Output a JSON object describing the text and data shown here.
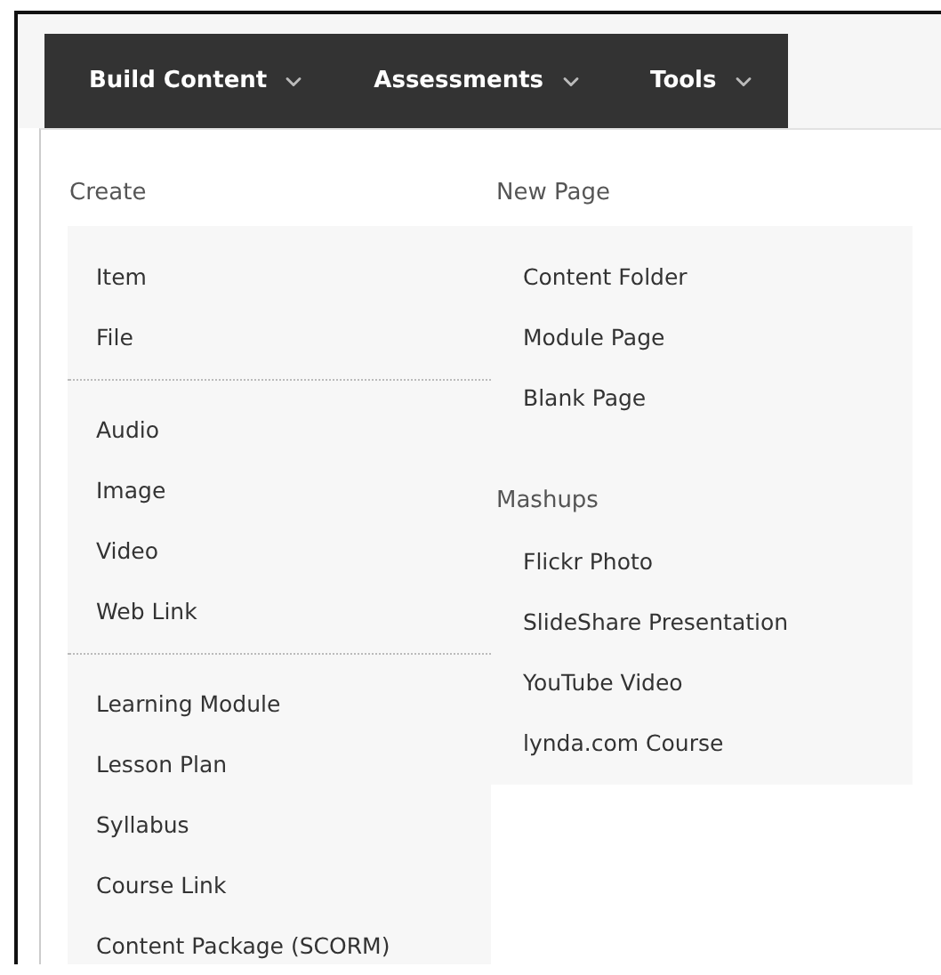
{
  "nav": [
    {
      "label": "Build Content"
    },
    {
      "label": "Assessments"
    },
    {
      "label": "Tools"
    }
  ],
  "menu": {
    "columns": [
      {
        "heading": "Create",
        "sections": [
          {
            "items": [
              "Item",
              "File"
            ]
          },
          {
            "items": [
              "Audio",
              "Image",
              "Video",
              "Web Link"
            ]
          },
          {
            "items": [
              "Learning Module",
              "Lesson Plan",
              "Syllabus",
              "Course Link",
              "Content Package (SCORM)"
            ]
          }
        ]
      },
      {
        "heading": "New Page",
        "sections": [
          {
            "items": [
              "Content Folder",
              "Module Page",
              "Blank Page"
            ]
          },
          {
            "heading": "Mashups",
            "items": [
              "Flickr Photo",
              "SlideShare Presentation",
              "YouTube Video",
              "lynda.com Course"
            ]
          }
        ]
      }
    ]
  }
}
